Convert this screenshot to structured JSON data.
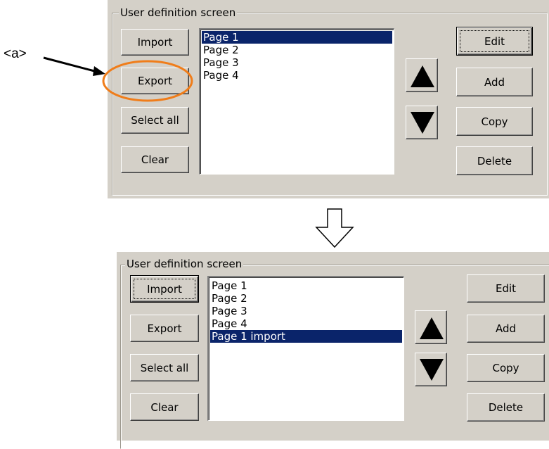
{
  "annotation": {
    "label": "<a>"
  },
  "top_window": {
    "group_title": "User definition screen",
    "left_buttons": [
      "Import",
      "Export",
      "Select all",
      "Clear"
    ],
    "list_items": [
      "Page 1",
      "Page 2",
      "Page 3",
      "Page 4"
    ],
    "selected_item": "Page 1",
    "right_buttons": [
      "Edit",
      "Add",
      "Copy",
      "Delete"
    ],
    "default_button": "Edit",
    "highlighted_button": "Export"
  },
  "bottom_window": {
    "group_title": "User definition screen",
    "left_buttons": [
      "Import",
      "Export",
      "Select all",
      "Clear"
    ],
    "list_items": [
      "Page 1",
      "Page 2",
      "Page 3",
      "Page 4",
      "Page 1 import"
    ],
    "selected_item": "Page 1 import",
    "right_buttons": [
      "Edit",
      "Add",
      "Copy",
      "Delete"
    ],
    "default_button": "Import"
  },
  "colors": {
    "panel": "#d4d0c8",
    "selection": "#0a246a",
    "highlight_ellipse": "#f07d1a"
  },
  "icons": {
    "up": "triangle-up-icon",
    "down": "triangle-down-icon",
    "transition": "hollow-down-arrow-icon"
  }
}
